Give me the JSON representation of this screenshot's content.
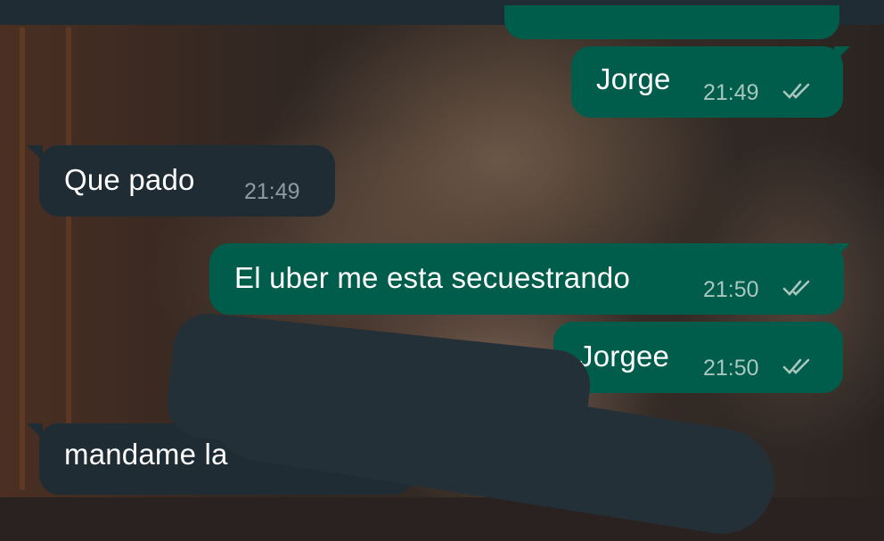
{
  "messages": [
    {
      "id": "m1",
      "direction": "outgoing",
      "text": "Jorge",
      "time": "21:49",
      "status": "read"
    },
    {
      "id": "m2",
      "direction": "incoming",
      "text": "Que pado",
      "time": "21:49"
    },
    {
      "id": "m3",
      "direction": "outgoing",
      "text": "El uber me esta secuestrando",
      "time": "21:50",
      "status": "read"
    },
    {
      "id": "m4",
      "direction": "outgoing",
      "text": "Jorgee",
      "time": "21:50",
      "status": "read"
    },
    {
      "id": "m5",
      "direction": "incoming",
      "text": "mandame la",
      "time": "",
      "partially_redacted": true
    }
  ],
  "icons": {
    "read_receipt": "double-check-icon"
  },
  "colors": {
    "outgoing_bubble": "#005c4b",
    "incoming_bubble": "#1f2c34",
    "header_bar": "#1f2c34",
    "read_ticks": "#a9c7bf"
  }
}
